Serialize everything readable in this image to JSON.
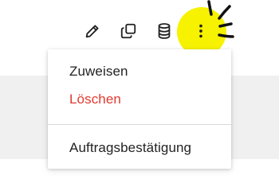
{
  "toolbar": {
    "icons": [
      "pencil-icon",
      "copy-icon",
      "database-icon",
      "more-vertical-icon"
    ],
    "highlight_color": "#f6f200"
  },
  "menu": {
    "items": [
      {
        "label": "Zuweisen"
      },
      {
        "label": "Löschen",
        "color": "#e03a30"
      },
      {
        "label": "Auftragsbestätigung"
      }
    ]
  }
}
